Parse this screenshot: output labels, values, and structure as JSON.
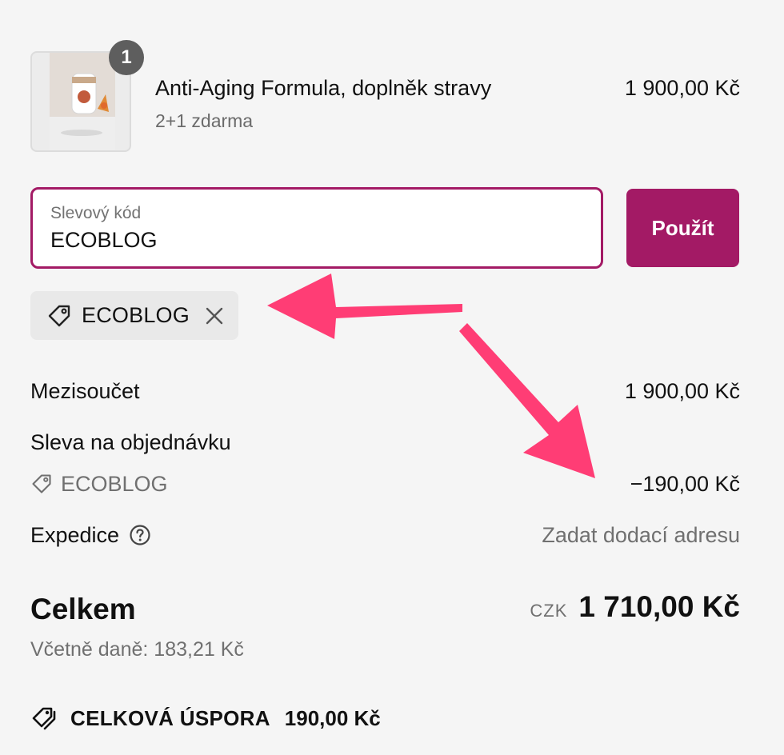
{
  "line_item": {
    "quantity": "1",
    "name": "Anti-Aging Formula, doplněk stravy",
    "variant": "2+1 zdarma",
    "price": "1 900,00 Kč"
  },
  "discount": {
    "label": "Slevový kód",
    "value": "ECOBLOG",
    "apply_label": "Použít",
    "applied_code": "ECOBLOG"
  },
  "summary": {
    "subtotal_label": "Mezisoučet",
    "subtotal_value": "1 900,00 Kč",
    "order_discount_label": "Sleva na objednávku",
    "order_discount_code": "ECOBLOG",
    "order_discount_value": "−190,00 Kč",
    "shipping_label": "Expedice",
    "shipping_value": "Zadat dodací adresu",
    "total_label": "Celkem",
    "total_currency": "CZK",
    "total_value": "1 710,00 Kč",
    "tax_line": "Včetně daně: 183,21 Kč",
    "savings_label": "CELKOVÁ ÚSPORA",
    "savings_value": "190,00 Kč"
  },
  "colors": {
    "accent": "#a31a65",
    "annotation_arrow": "#ff3d75",
    "background": "#f5f5f5"
  },
  "icons": [
    "tag-icon",
    "close-icon",
    "help-circle-icon",
    "tags-icon"
  ]
}
